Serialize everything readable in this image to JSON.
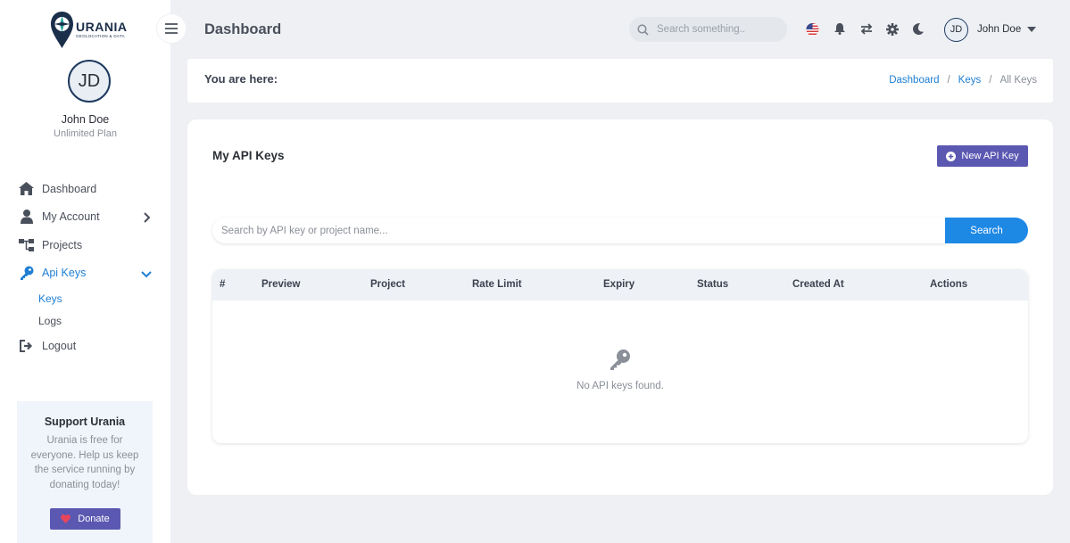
{
  "brand": {
    "name": "URANIA",
    "tagline": "GEOLOCATION & DATA"
  },
  "profile": {
    "initials": "JD",
    "name": "John Doe",
    "plan": "Unlimited Plan"
  },
  "sidebar": {
    "items": [
      {
        "label": "Dashboard",
        "icon": "home-icon"
      },
      {
        "label": "My Account",
        "icon": "user-icon"
      },
      {
        "label": "Projects",
        "icon": "sitemap-icon"
      },
      {
        "label": "Api Keys",
        "icon": "key-icon"
      },
      {
        "label": "Logout",
        "icon": "logout-icon"
      }
    ],
    "subitems": [
      {
        "label": "Keys"
      },
      {
        "label": "Logs"
      }
    ]
  },
  "support": {
    "title": "Support Urania",
    "text": "Urania is free for everyone. Help us keep the service running by donating today!",
    "button": "Donate"
  },
  "header": {
    "title": "Dashboard",
    "search_placeholder": "Search something..",
    "user_initials": "JD",
    "user_name": "John Doe"
  },
  "breadcrumb": {
    "label": "You are here:",
    "items": [
      "Dashboard",
      "Keys",
      "All Keys"
    ],
    "separator": "/"
  },
  "main": {
    "title": "My API Keys",
    "new_button": "New API Key",
    "search_placeholder": "Search by API key or project name...",
    "search_button": "Search",
    "columns": [
      "#",
      "Preview",
      "Project",
      "Rate Limit",
      "Expiry",
      "Status",
      "Created At",
      "Actions"
    ],
    "empty_text": "No API keys found."
  },
  "colors": {
    "accent": "#1e88e5",
    "primary_button": "#5b58b2",
    "active_nav": "#1e7fd4"
  }
}
